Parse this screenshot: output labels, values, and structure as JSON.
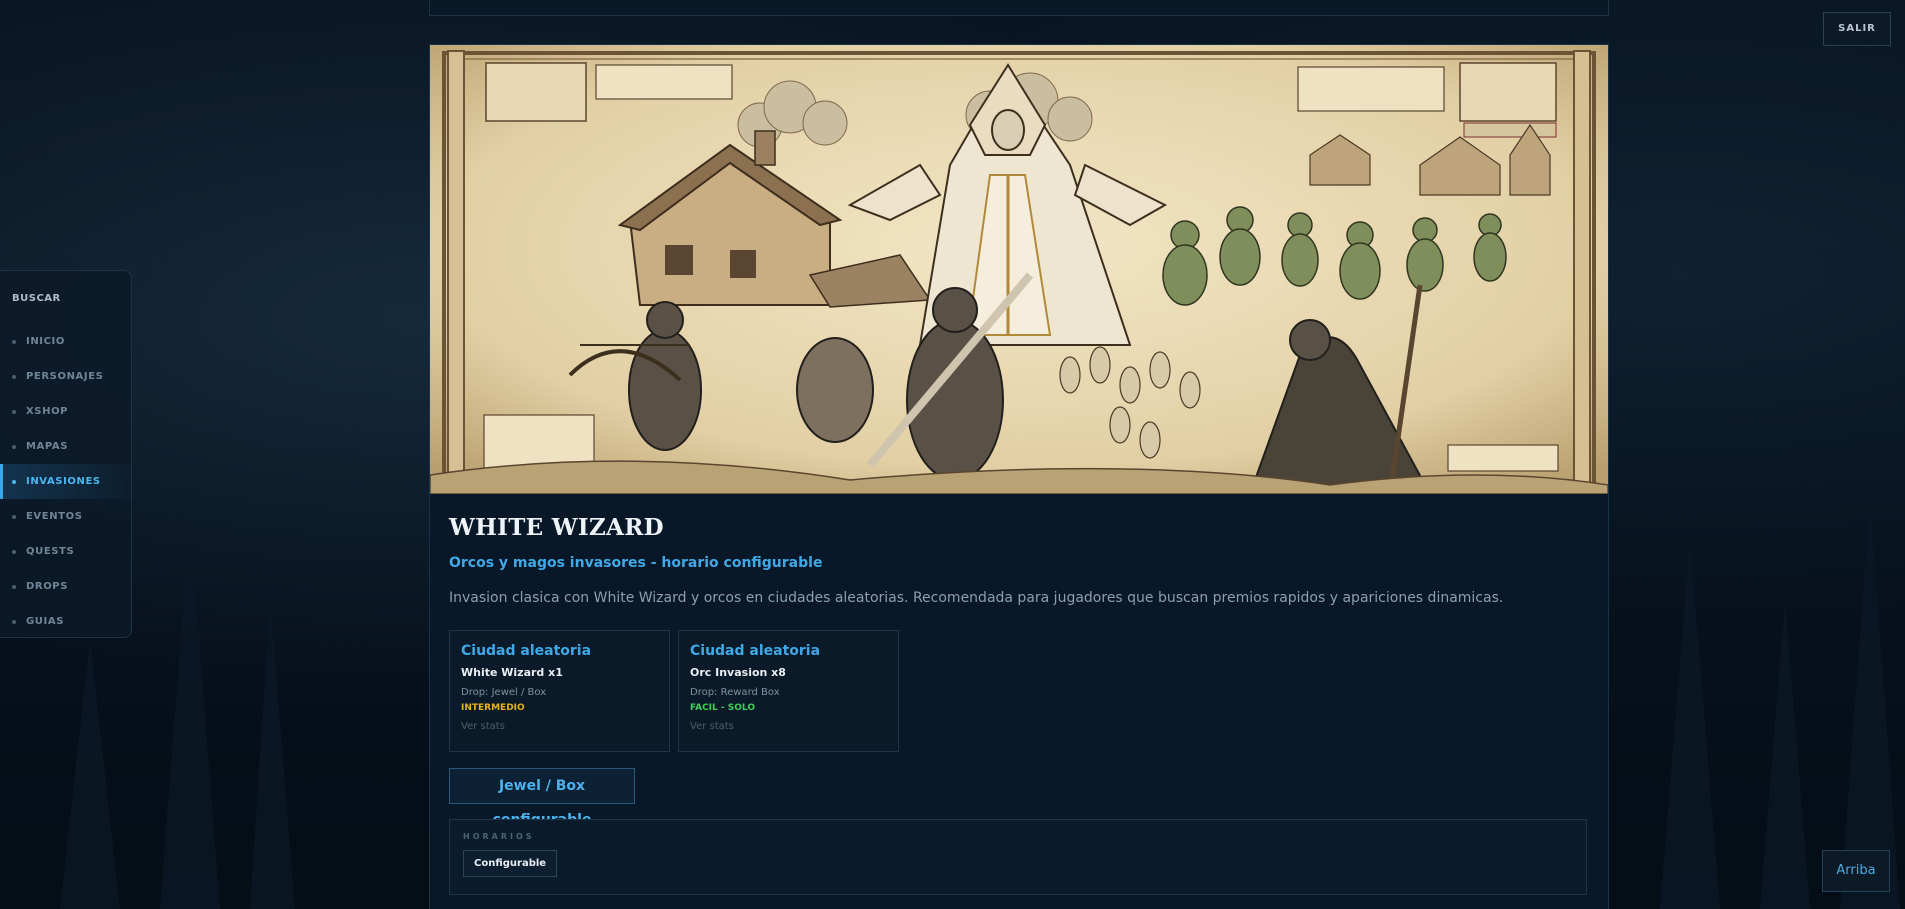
{
  "sidebar": {
    "heading": "BUSCAR",
    "items": [
      {
        "label": "INICIO"
      },
      {
        "label": "PERSONAJES"
      },
      {
        "label": "XSHOP"
      },
      {
        "label": "MAPAS"
      },
      {
        "label": "INVASIONES",
        "active": true
      },
      {
        "label": "EVENTOS"
      },
      {
        "label": "QUESTS"
      },
      {
        "label": "DROPS"
      },
      {
        "label": "GUIAS"
      }
    ]
  },
  "header": {
    "logout_label": "SALIR"
  },
  "footer": {
    "back_to_top_label": "Arriba"
  },
  "event": {
    "title": "WHITE WIZARD",
    "subtitle": "Orcos y magos invasores - horario configurable",
    "description": "Invasion clasica con White Wizard y orcos en ciudades aleatorias. Recomendada para jugadores que buscan premios rapidos y apariciones dinamicas.",
    "spawns": [
      {
        "place": "Ciudad aleatoria",
        "name": "White Wizard x1",
        "drop": "Drop: Jewel / Box",
        "level": "INTERMEDIO",
        "level_color": "#e8b21c",
        "stats_link": "Ver stats"
      },
      {
        "place": "Ciudad aleatoria",
        "name": "Orc Invasion x8",
        "drop": "Drop: Reward Box",
        "level": "FACIL - SOLO",
        "level_color": "#3ecf5a",
        "stats_link": "Ver stats"
      }
    ],
    "reward_button": "Jewel / Box configurable",
    "schedule": {
      "label": "HORARIOS",
      "value": "Configurable"
    }
  },
  "colors": {
    "accent": "#3fa9e8",
    "background": "#06111c"
  }
}
